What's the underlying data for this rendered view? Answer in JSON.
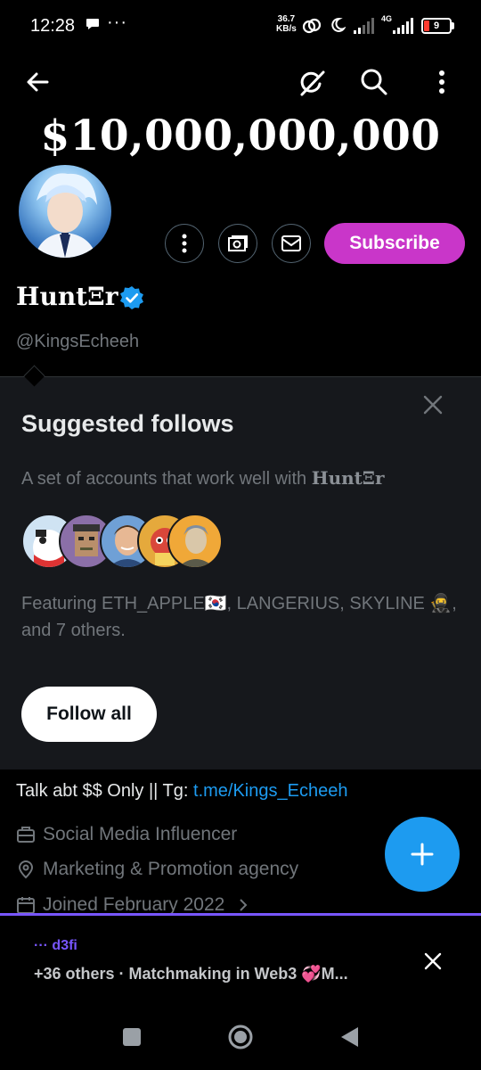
{
  "status_bar": {
    "time": "12:28",
    "net_speed_value": "36.7",
    "net_speed_unit": "KB/s",
    "network_type": "4G",
    "battery": "9"
  },
  "profile": {
    "banner_text": "$10,000,000,000",
    "display_name": "HuntΞr",
    "handle": "@KingsEcheeh",
    "subscribe_label": "Subscribe",
    "bio_text": "Talk abt $$ Only || Tg: ",
    "bio_link": "t.me/Kings_Echeeh",
    "category": "Social Media Influencer",
    "location": "Marketing & Promotion agency",
    "joined": "Joined February 2022"
  },
  "suggested": {
    "title": "Suggested follows",
    "subtitle_prefix": "A set of accounts that work well with ",
    "subtitle_name": "HuntΞr",
    "featuring": "Featuring ETH_APPLE🇰🇷, LANGERIUS, SKYLINE 🥷, and 7 others.",
    "follow_all_label": "Follow all"
  },
  "space_bar": {
    "host": "··· d3fi",
    "description": "+36 others · Matchmaking in Web3 💞M..."
  },
  "icons": {
    "back": "arrow-left-icon",
    "grok": "grok-icon",
    "search": "search-icon",
    "more": "more-vertical-icon"
  },
  "colors": {
    "accent_blue": "#1d9bf0",
    "subscribe_magenta": "#c936c9",
    "spaces_purple": "#7856ff"
  }
}
